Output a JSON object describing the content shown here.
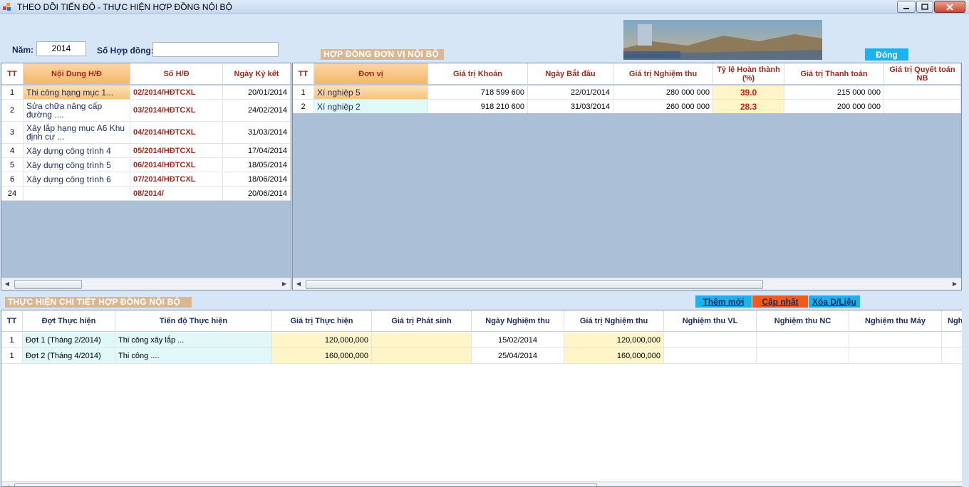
{
  "window": {
    "title": "THEO DÕI TIẾN ĐỘ - THỰC HIỆN HỢP ĐỒNG NỘI BỘ"
  },
  "filters": {
    "year_label": "Năm:",
    "year_value": "2014",
    "contract_label": "Số Hợp đồng:",
    "contract_value": ""
  },
  "sections": {
    "unit_contracts": "HỢP ĐỒNG ĐƠN VỊ NỘI BỘ",
    "detail": "THỰC HIỆN CHI TIẾT HỢP ĐỒNG NỘI BỘ"
  },
  "buttons": {
    "close": "Đóng",
    "add": "Thêm mới",
    "update": "Cập nhật",
    "delete": "Xóa D/Liệu"
  },
  "contracts": {
    "headers": [
      "TT",
      "Nội Dung H/Đ",
      "Số H/Đ",
      "Ngày Ký kết"
    ],
    "rows": [
      {
        "tt": "1",
        "content": "Thi công hạng mục 1...",
        "number": "02/2014/HĐTCXL",
        "date": "20/01/2014"
      },
      {
        "tt": "2",
        "content": "Sửa chữa nâng cấp đường ....",
        "number": "03/2014/HĐTCXL",
        "date": "24/02/2014"
      },
      {
        "tt": "3",
        "content": "Xây lắp hạng mục A6 Khu định cư ...",
        "number": "04/2014/HĐTCXL",
        "date": "31/03/2014"
      },
      {
        "tt": "4",
        "content": "Xây dựng công trình 4",
        "number": "05/2014/HĐTCXL",
        "date": "17/04/2014"
      },
      {
        "tt": "5",
        "content": "Xây dựng công trình 5",
        "number": "06/2014/HĐTCXL",
        "date": "18/05/2014"
      },
      {
        "tt": "6",
        "content": "Xây dựng công trình 6",
        "number": "07/2014/HĐTCXL",
        "date": "18/06/2014"
      },
      {
        "tt": "24",
        "content": "",
        "number": "08/2014/",
        "date": "20/06/2014"
      }
    ]
  },
  "units": {
    "headers": [
      "TT",
      "Đơn vị",
      "Giá trị Khoán",
      "Ngày Bắt đầu",
      "Giá trị Nghiệm thu",
      "Tỷ lệ Hoàn thành (%)",
      "Giá trị Thanh toán",
      "Giá trị Quyết toán NB"
    ],
    "rows": [
      {
        "tt": "1",
        "unit": "Xí nghiệp 5",
        "contract_value": "718 599 600",
        "start": "22/01/2014",
        "accepted": "280 000 000",
        "rate": "39.0",
        "paid": "215 000 000",
        "settled": ""
      },
      {
        "tt": "2",
        "unit": "Xí nghiệp 2",
        "contract_value": "918 210 600",
        "start": "31/03/2014",
        "accepted": "260 000 000",
        "rate": "28.3",
        "paid": "200 000 000",
        "settled": ""
      }
    ]
  },
  "details": {
    "headers": [
      "TT",
      "Đợt Thực hiện",
      "Tiến độ Thực hiện",
      "Giá trị Thực hiện",
      "Giá trị Phát sinh",
      "Ngày Nghiệm thu",
      "Giá trị Nghiệm thu",
      "Nghiệm thu VL",
      "Nghiệm thu NC",
      "Nghiệm thu Máy",
      "Ngh"
    ],
    "rows": [
      {
        "tt": "1",
        "phase": "Đợt 1 (Tháng 2/2014)",
        "progress": "Thi công xây lắp ...",
        "value": "120,000,000",
        "extra": "",
        "date": "15/02/2014",
        "accepted": "120,000,000"
      },
      {
        "tt": "1",
        "phase": "Đợt 2 (Tháng 4/2014)",
        "progress": "Thi công ....",
        "value": "160,000,000",
        "extra": "",
        "date": "25/04/2014",
        "accepted": "160,000,000"
      }
    ]
  },
  "colors": {
    "section_bg": "#d9b78f",
    "header_text": "#a0281e",
    "close_btn": "#1ab3ee",
    "add_btn": "#1ab3ee",
    "update_btn": "#f25a17",
    "delete_btn": "#1ab3ee",
    "rate_bg": "#fff5c9",
    "selected_header": "#f4b76a"
  },
  "icons": [
    "app-icon",
    "minimize-icon",
    "maximize-icon",
    "close-icon",
    "banner-image"
  ]
}
